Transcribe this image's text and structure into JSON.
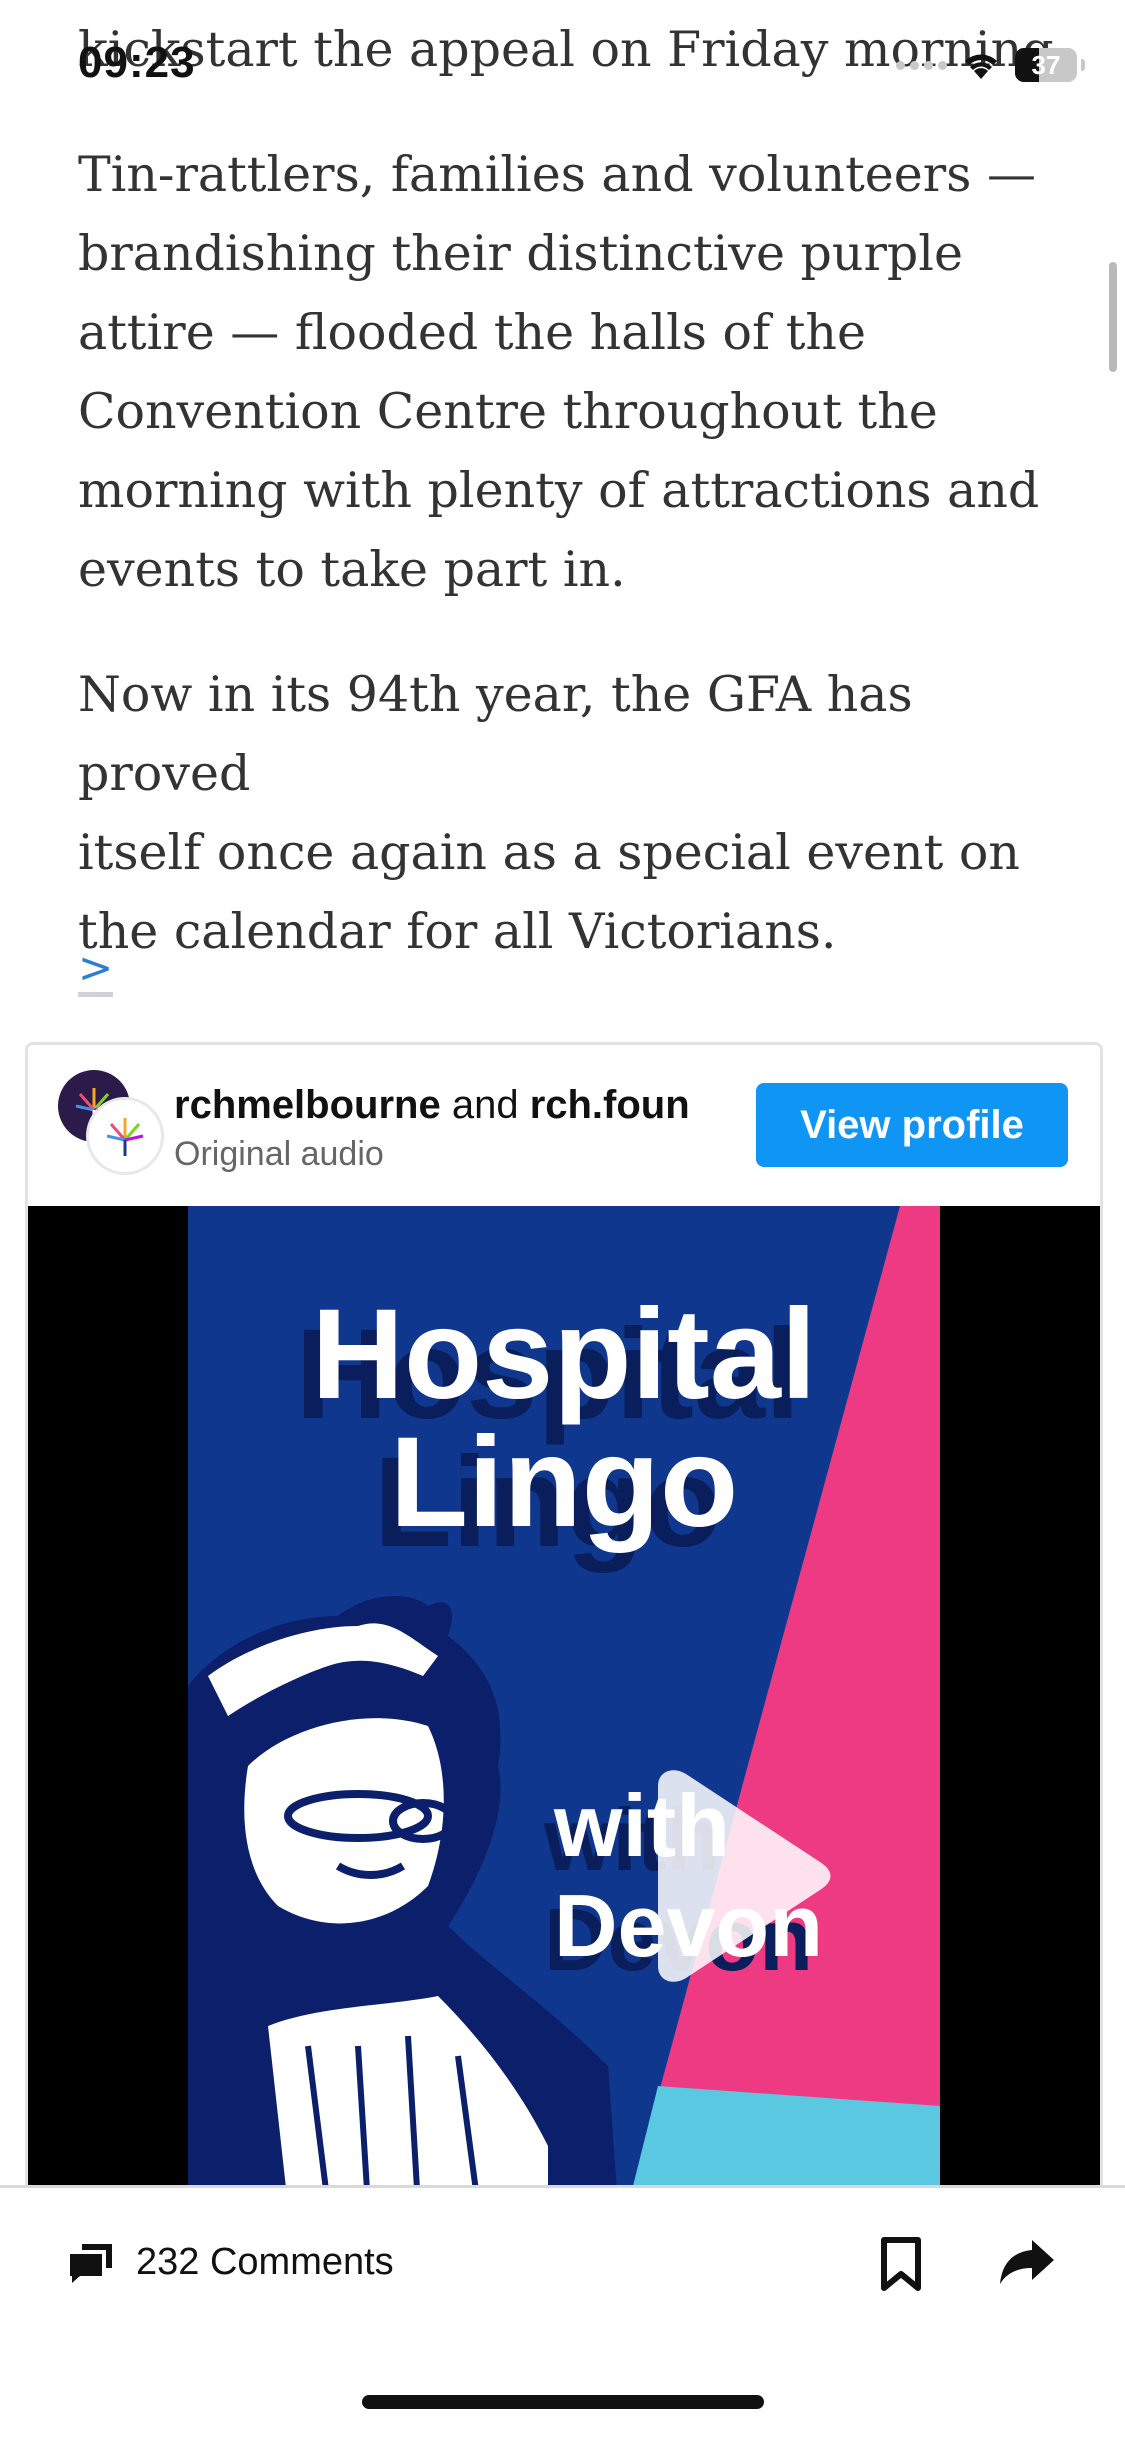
{
  "status_bar": {
    "time": "09:23",
    "battery_level": "37"
  },
  "article": {
    "line_top": "kickstart the appeal on Friday morning.",
    "paragraph_1_lines": [
      "Tin-rattlers, families and volunteers —",
      "brandishing their distinctive purple",
      "attire — flooded the halls of the",
      "Convention Centre throughout the",
      "morning with plenty of attractions and",
      "events to take part in."
    ],
    "paragraph_2_lines": [
      "Now in its 94th year, the GFA has proved",
      "itself once again as a special event on",
      "the calendar for all Victorians."
    ],
    "more_link": ">"
  },
  "embed": {
    "account_1": "rchmelbourne",
    "connector": " and ",
    "account_2": "rch.foun",
    "subtitle": "Original audio",
    "view_profile_label": "View profile",
    "video": {
      "title_lines": [
        "Hospital",
        "Lingo"
      ],
      "sub_lines": [
        "with",
        "Devon"
      ]
    }
  },
  "bottom_bar": {
    "comments_label": "232 Comments",
    "icons": [
      "comments-icon",
      "bookmark-icon",
      "share-icon"
    ]
  },
  "colors": {
    "link": "#2a7fd4",
    "button": "#0f95f3",
    "video_blue": "#10378e",
    "video_pink": "#ee3a83",
    "video_cyan": "#5ac8e0"
  }
}
